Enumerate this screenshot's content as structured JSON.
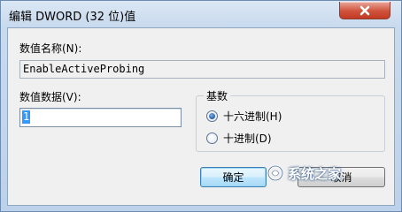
{
  "window": {
    "title": "编辑 DWORD (32 位)值"
  },
  "fields": {
    "name_label": "数值名称(N):",
    "name_value": "EnableActiveProbing",
    "data_label": "数值数据(V):",
    "data_value": "1"
  },
  "base_group": {
    "title": "基数",
    "options": [
      {
        "label": "十六进制(H)",
        "checked": true
      },
      {
        "label": "十进制(D)",
        "checked": false
      }
    ]
  },
  "buttons": {
    "ok_label": "确定",
    "cancel_label": "取消"
  },
  "watermark": {
    "text": "系统之家"
  },
  "icons": {
    "close": "close-icon",
    "watermark_logo": "watermark-logo-icon"
  },
  "colors": {
    "selection": "#3399ff",
    "close_button": "#c94a33",
    "dialog_face": "#f0f0f0"
  }
}
